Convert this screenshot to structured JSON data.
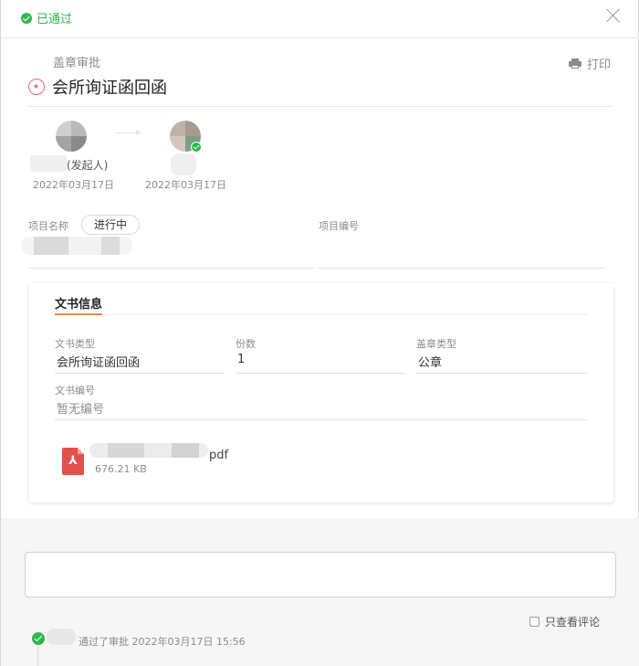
{
  "header": {
    "status": "已通过",
    "close_icon": "close-icon"
  },
  "form": {
    "category": "盖章审批",
    "title": "会所询证函回函",
    "print_label": "打印"
  },
  "flow": {
    "initiator_role": "(发起人)",
    "initiator_date": "2022年03月17日",
    "approver_date": "2022年03月17日"
  },
  "project": {
    "name_label": "项目名称",
    "status_tag": "进行中",
    "code_label": "项目编号"
  },
  "document": {
    "section_title": "文书信息",
    "type_label": "文书类型",
    "type_value": "会所询证函回函",
    "copies_label": "份数",
    "copies_value": "1",
    "seal_type_label": "盖章类型",
    "seal_type_value": "公章",
    "number_label": "文书编号",
    "number_value": "暂无编号",
    "file_ext": "pdf",
    "file_size": "676.21 KB"
  },
  "comments": {
    "only_comments_label": "只查看评论",
    "timeline_text": "通过了审批 2022年03月17日 15:56"
  },
  "colors": {
    "success": "#2db84d",
    "accent": "#f0883e",
    "pdf": "#e2504c"
  }
}
